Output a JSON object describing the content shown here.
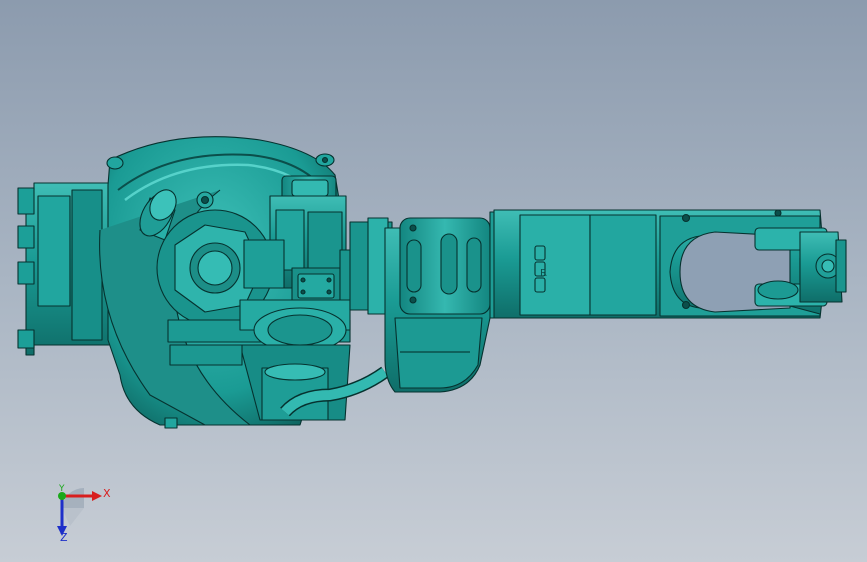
{
  "viewport": {
    "background_top": "#8c9bae",
    "background_bottom": "#c7cdd5"
  },
  "model": {
    "description_icon": "robot-arm-model",
    "colors": {
      "body": "#1a9b94",
      "highlight": "#4fcac2",
      "shadow": "#0d5e5a",
      "edge": "#06322f"
    },
    "engraved_marks": [
      "R"
    ]
  },
  "triad": {
    "x_label": "X",
    "y_label": "Y",
    "z_label": "Z",
    "x_color": "#d81e1e",
    "y_color": "#1aa81a",
    "z_color": "#1d2fc9"
  }
}
